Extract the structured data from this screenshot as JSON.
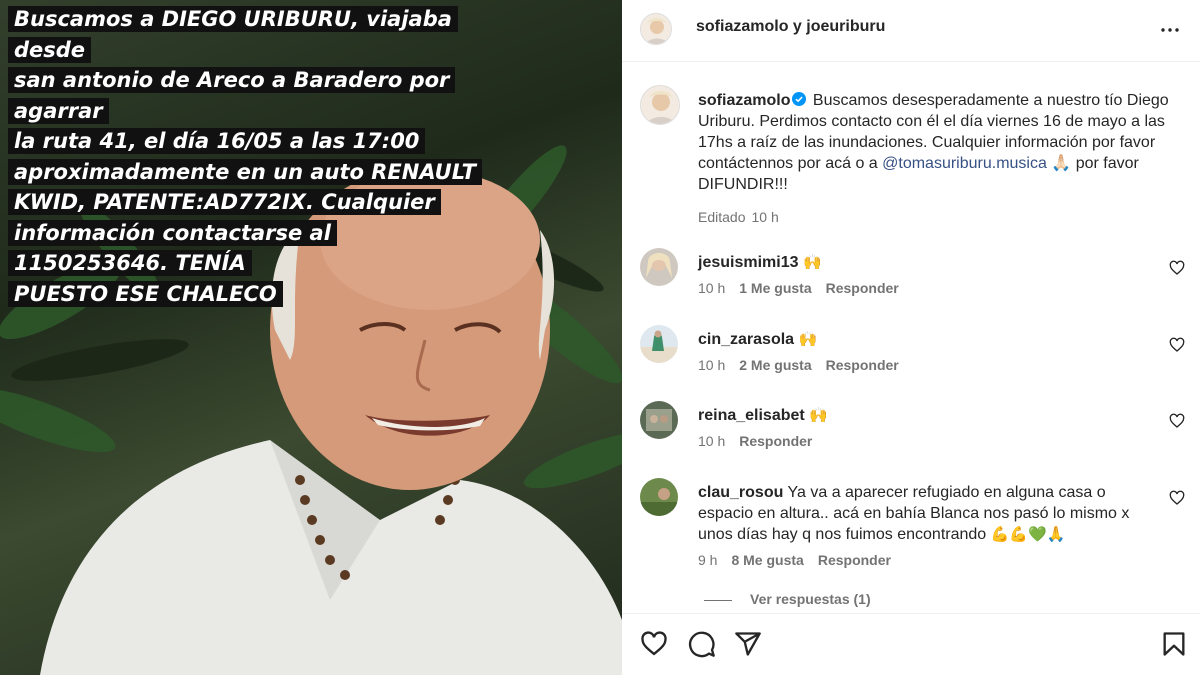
{
  "media": {
    "caption_lines": [
      "Buscamos a DIEGO URIBURU, viajaba desde",
      "san antonio de Areco a Baradero por agarrar",
      "la ruta 41, el día 16/05 a las 17:00",
      "aproximadamente en un auto RENAULT",
      "KWID, PATENTE:AD772IX. Cualquier",
      "información contactarse al",
      "1150253646. TENÍA",
      "PUESTO ESE CHALECO"
    ]
  },
  "header": {
    "title": "sofiazamolo y joeuriburu",
    "more_icon": "more-horizontal-icon"
  },
  "post": {
    "username": "sofiazamolo",
    "text_before": "Buscamos desesperadamente a nuestro tío Diego Uriburu. Perdimos contacto con él el día viernes 16 de mayo a las 17hs a raíz de las inundaciones. Cualquier información por favor contáctennos por acá o a ",
    "mention": "@tomasuriburu.musica",
    "text_after": " 🙏🏻 por favor DIFUNDIR!!!",
    "edited": "Editado",
    "time": "10 h"
  },
  "comments": [
    {
      "username": "jesuismimi13",
      "text": "",
      "emoji": "🙌",
      "time": "10 h",
      "likes": "1 Me gusta",
      "reply": "Responder"
    },
    {
      "username": "cin_zarasola",
      "text": "",
      "emoji": "🙌",
      "time": "10 h",
      "likes": "2 Me gusta",
      "reply": "Responder"
    },
    {
      "username": "reina_elisabet",
      "text": "",
      "emoji": "🙌",
      "time": "10 h",
      "likes": "",
      "reply": "Responder"
    },
    {
      "username": "clau_rosou",
      "text": "Ya va a aparecer refugiado en alguna casa o espacio en altura.. acá en bahía Blanca nos pasó lo mismo x unos días hay q nos fuimos encontrando",
      "emoji": "💪💪💚🙏",
      "time": "9 h",
      "likes": "8 Me gusta",
      "reply": "Responder"
    }
  ],
  "view_replies": "Ver respuestas (1)",
  "colors": {
    "link": "#385185",
    "verified": "#0095f6",
    "muted": "#737373"
  }
}
